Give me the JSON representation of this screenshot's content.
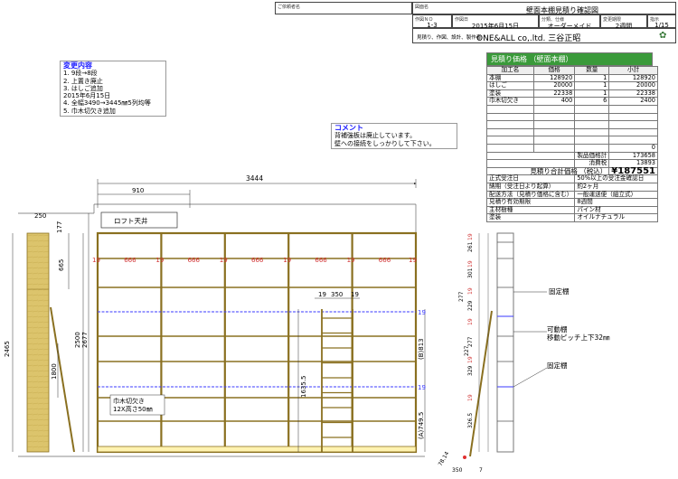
{
  "header": {
    "customer_label": "ご依頼者名",
    "customer_name": "",
    "drawing_label": "図面名",
    "drawing_name": "壁面本棚見積り確認図",
    "drawing_no_label": "作図ＮＯ",
    "drawing_no": "1-3",
    "date_label": "作図日",
    "date": "2015年6月15日",
    "category_label": "分類、仕様",
    "category": "オーダーメイド",
    "period_label": "変更期限",
    "period": "2週間",
    "page_label": "指示",
    "page": "1/15",
    "company_caption": "見積り、作図、設計、製作者",
    "company": "ONE&ALL co,.ltd. 三谷正昭"
  },
  "changes": {
    "title": "変更内容",
    "lines": [
      "1. 9段→8段",
      "2. 上置き廃止",
      "3. はしご追加",
      "2015年6月15日",
      "4. 全幅3490→3445㎜5列均等",
      "5. 巾木切欠き追加"
    ]
  },
  "comment": {
    "title": "コメント",
    "lines": [
      "背補強板は廃止しています。",
      "壁への接続をしっかりして下さい。"
    ]
  },
  "estimate": {
    "title": "見積り価格 （壁面本棚）",
    "headers": [
      "加工名",
      "価格",
      "数量",
      "小計"
    ],
    "rows": [
      [
        "本棚",
        "128920",
        "1",
        "128920"
      ],
      [
        "はしご",
        "20000",
        "1",
        "20000"
      ],
      [
        "塗装",
        "22338",
        "1",
        "22338"
      ],
      [
        "巾木切欠き",
        "400",
        "6",
        "2400"
      ],
      [
        "",
        "",
        "",
        ""
      ],
      [
        "",
        "",
        "",
        ""
      ],
      [
        "",
        "",
        "",
        ""
      ],
      [
        "",
        "",
        "",
        ""
      ],
      [
        "",
        "",
        "",
        ""
      ],
      [
        "",
        "",
        "",
        "0"
      ]
    ],
    "subtotal_label": "製品価格計",
    "subtotal": "173658",
    "tax_label": "消費税",
    "tax": "13893",
    "total_label": "見積り合計価格 （税込）",
    "total": "¥187551",
    "terms": [
      [
        "正式受注日",
        "50%以上の受注金確認日"
      ],
      [
        "納期（受注日より起算）",
        "約2ヶ月"
      ],
      [
        "配送方法（見積り価格に含む）",
        "一般運送便（組立式）"
      ],
      [
        "見積り有効期限",
        "8週間"
      ],
      [
        "主材樹種",
        "パイン材"
      ],
      [
        "塗装",
        "オイルナチュラル"
      ]
    ]
  },
  "front": {
    "total_width": "3444",
    "loft_width": "910",
    "loft_label": "ロフト天井",
    "col_label": "666",
    "panel_label": "19",
    "ladder_width": "350",
    "ladder_left": "19",
    "ladder_right": "19",
    "height_2500": "2500",
    "height_2677": "2677",
    "height_665": "665",
    "height_1635": "1635.5",
    "height_1800": "1800",
    "shelf_b813": "(B)813",
    "shelf_a749": "(A)749.5",
    "wall_2465": "2465",
    "wall_250": "250",
    "wall_177": "177",
    "kick_note_title": "巾木切欠き",
    "kick_note": "12X高さ50㎜"
  },
  "side": {
    "fixed_label": "固定棚",
    "movable_label": "可動棚",
    "pitch_label": "移動ピッチ上下32㎜",
    "dims_right": [
      "19",
      "261",
      "19",
      "301",
      "19",
      "229",
      "19",
      "277",
      "19",
      "329",
      "19",
      "326.5"
    ],
    "dims_left": [
      "277",
      "227"
    ],
    "bottom_dims": [
      "78.14",
      "350",
      "7"
    ]
  },
  "colors": {
    "wood": "#dcc46c",
    "wood_edge": "#8a7020",
    "movable": "#3a3aff",
    "accent": "#e03030",
    "note_title": "#1a1aff"
  }
}
